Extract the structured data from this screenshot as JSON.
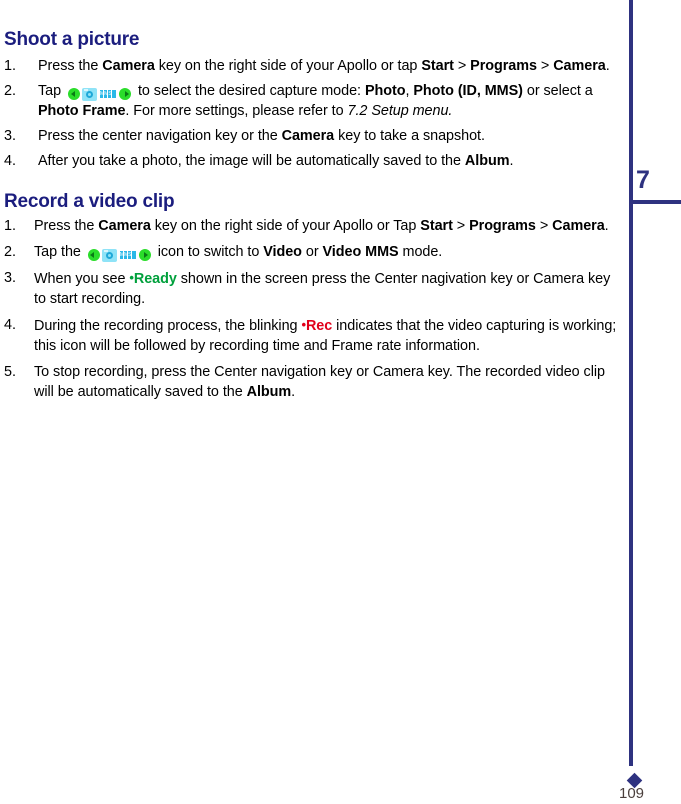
{
  "page": {
    "chapter_number": "7",
    "page_number": "109",
    "rule_color": "#2e3280",
    "heading_color": "#1b1d7e"
  },
  "sections": [
    {
      "heading": "Shoot a picture",
      "steps": [
        {
          "number": "1.",
          "parts": [
            {
              "t": "text",
              "v": "Press the "
            },
            {
              "t": "bold",
              "v": "Camera"
            },
            {
              "t": "text",
              "v": " key on the right side of your Apollo or tap "
            },
            {
              "t": "bold",
              "v": "Start"
            },
            {
              "t": "text",
              "v": " > "
            },
            {
              "t": "bold",
              "v": "Programs"
            },
            {
              "t": "text",
              "v": " > "
            },
            {
              "t": "bold",
              "v": "Camera"
            },
            {
              "t": "text",
              "v": "."
            }
          ]
        },
        {
          "number": "2.",
          "parts": [
            {
              "t": "text",
              "v": "Tap "
            },
            {
              "t": "icons",
              "v": "mode-switch-strip"
            },
            {
              "t": "text",
              "v": " to select the desired capture mode: "
            },
            {
              "t": "bold",
              "v": "Photo"
            },
            {
              "t": "text",
              "v": ", "
            },
            {
              "t": "bold",
              "v": "Photo (ID, MMS)"
            },
            {
              "t": "text",
              "v": " or select a "
            },
            {
              "t": "bold",
              "v": "Photo Frame"
            },
            {
              "t": "text",
              "v": ". For more settings, please refer to "
            },
            {
              "t": "italic",
              "v": "7.2 Setup menu."
            }
          ]
        },
        {
          "number": "3.",
          "parts": [
            {
              "t": "text",
              "v": "Press the center navigation key or the "
            },
            {
              "t": "bold",
              "v": "Camera"
            },
            {
              "t": "text",
              "v": " key to take a snapshot."
            }
          ]
        },
        {
          "number": "4.",
          "parts": [
            {
              "t": "text",
              "v": "After you take a photo, the image will be automatically saved to the "
            },
            {
              "t": "bold",
              "v": "Album"
            },
            {
              "t": "text",
              "v": "."
            }
          ]
        }
      ]
    },
    {
      "heading": "Record a video clip",
      "steps": [
        {
          "number": "1.",
          "parts": [
            {
              "t": "text",
              "v": "Press the "
            },
            {
              "t": "bold",
              "v": "Camera"
            },
            {
              "t": "text",
              "v": " key on the right side of your Apollo or Tap "
            },
            {
              "t": "bold",
              "v": "Start"
            },
            {
              "t": "text",
              "v": " > "
            },
            {
              "t": "bold",
              "v": "Programs"
            },
            {
              "t": "text",
              "v": " > "
            },
            {
              "t": "bold",
              "v": "Camera"
            },
            {
              "t": "text",
              "v": "."
            }
          ]
        },
        {
          "number": "2.",
          "parts": [
            {
              "t": "text",
              "v": "Tap the "
            },
            {
              "t": "icons",
              "v": "mode-switch-strip"
            },
            {
              "t": "text",
              "v": " icon to switch to "
            },
            {
              "t": "bold",
              "v": "Video"
            },
            {
              "t": "text",
              "v": " or "
            },
            {
              "t": "bold",
              "v": "Video MMS"
            },
            {
              "t": "text",
              "v": " mode."
            }
          ]
        },
        {
          "number": "3.",
          "parts": [
            {
              "t": "text",
              "v": "When you see "
            },
            {
              "t": "ready",
              "v": "Ready"
            },
            {
              "t": "text",
              "v": " shown in the screen press the Center nagivation key or Camera key to start recording."
            }
          ]
        },
        {
          "number": "4.",
          "parts": [
            {
              "t": "text",
              "v": "During the recording process, the blinking "
            },
            {
              "t": "rec",
              "v": "Rec"
            },
            {
              "t": "text",
              "v": " indicates that the video capturing is working; this icon will be followed by recording time and Frame rate information."
            }
          ]
        },
        {
          "number": "5.",
          "parts": [
            {
              "t": "text",
              "v": "To stop recording, press the Center navigation key or Camera key. The recorded video clip will be automatically saved to the "
            },
            {
              "t": "bold",
              "v": "Album"
            },
            {
              "t": "text",
              "v": "."
            }
          ]
        }
      ]
    }
  ],
  "icons": {
    "mode_strip": {
      "left_arrow": "arrow-left-circle-icon",
      "camera": "camera-icon",
      "mms": "MMS",
      "right_arrow": "arrow-right-circle-icon"
    }
  },
  "status_labels": {
    "ready": "Ready",
    "rec": "Rec",
    "dot": "•"
  }
}
